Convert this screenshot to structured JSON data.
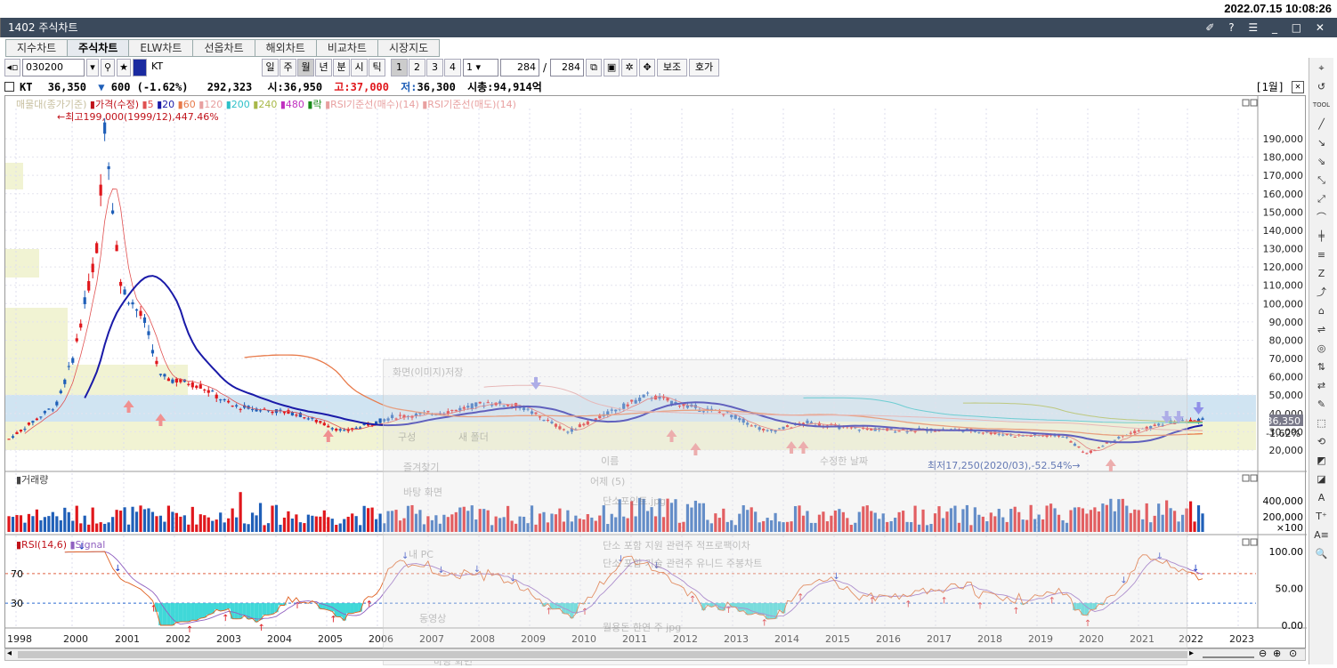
{
  "clock": "2022.07.15 10:08:26",
  "window": {
    "title": "1402 주식차트",
    "controls": "✐ ? ☰ _ □ ✕"
  },
  "tabs": [
    "지수차트",
    "주식차트",
    "ELW차트",
    "선옵차트",
    "해외차트",
    "비교차트",
    "시장지도"
  ],
  "active_tab": "주식차트",
  "toolbar": {
    "code": "030200",
    "name": "KT",
    "periods": [
      "일",
      "주",
      "월",
      "년",
      "분",
      "시",
      "틱"
    ],
    "nums": [
      "1",
      "2",
      "3",
      "4"
    ],
    "sel_num": "1",
    "count": "284",
    "total": "284",
    "aux": "보조",
    "quote": "호가"
  },
  "info": {
    "name": "KT",
    "price": "36,350",
    "arrow": "▼",
    "change": "600",
    "pct": "(-1.62%)",
    "volume": "292,323",
    "open_lbl": "시:",
    "open": "36,950",
    "high_lbl": "고:",
    "high": "37,000",
    "low_lbl": "저:",
    "low": "36,300",
    "cap_lbl": "시총:",
    "cap": "94,914억",
    "period": "[1월]"
  },
  "legend": {
    "zone": "매물대(종가기준)",
    "price": "가격(수정)",
    "ma": [
      "5",
      "20",
      "60",
      "120",
      "200",
      "240",
      "480"
    ],
    "rak": "락",
    "rsi_buy": "RSI기준선(매수)(14)",
    "rsi_sell": "RSI기준선(매도)(14)"
  },
  "annotations": {
    "high": "←최고199,000(1999/12),447.46%",
    "low": "최저17,250(2020/03),-52.54%→"
  },
  "price_axis": [
    "190,000",
    "180,000",
    "170,000",
    "160,000",
    "150,000",
    "140,000",
    "130,000",
    "120,000",
    "110,000",
    "100,000",
    "90,000",
    "80,000",
    "70,000",
    "60,000",
    "50,000",
    "40,000",
    "30,000",
    "20,000"
  ],
  "price_tag": {
    "price": "36,350",
    "pct": "-1.62%"
  },
  "volume_panel": {
    "title": "거래량",
    "axis": [
      "400,000",
      "200,000",
      "×100"
    ]
  },
  "rsi_panel": {
    "title": "RSI(14,6)",
    "signal": "Signal",
    "levels": [
      "70",
      "30"
    ],
    "axis": [
      "100.00",
      "50.00",
      "0.00"
    ]
  },
  "years": [
    "1998",
    "2000",
    "2001",
    "2002",
    "2003",
    "2004",
    "2005",
    "2006",
    "2007",
    "2008",
    "2009",
    "2010",
    "2011",
    "2012",
    "2013",
    "2014",
    "2015",
    "2016",
    "2017",
    "2018",
    "2019",
    "2020",
    "2021",
    "2022",
    "2023"
  ],
  "overlay_text": [
    "화면(이미지)저장",
    "구성",
    "새 폴더",
    "즐겨찾기",
    "바탕 화면",
    "내 PC",
    "동영상",
    "바탕 화면",
    "이름",
    "수정한 날짜",
    "어제 (5)",
    "단소포인트.jpg",
    "단소 포함 지원 관련주 적프로팩이차",
    "단소 포함 기술 관련주 유니드 주봉차트",
    "월용돈 한연 주 jpg"
  ],
  "colors": {
    "up": "#e0171c",
    "down": "#1f5fb8",
    "ma20": "#1a1aa8",
    "ma60": "#e87a4a",
    "ma120": "#e8a0a0",
    "ma200": "#2ec0c8",
    "ma240": "#a8b848"
  }
}
